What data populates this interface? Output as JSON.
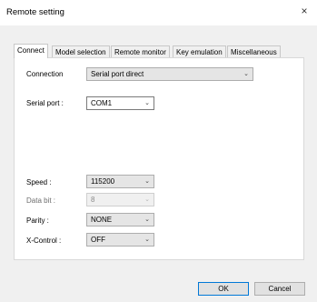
{
  "window": {
    "title": "Remote setting",
    "close_glyph": "×"
  },
  "tabs": [
    {
      "label": "Connect",
      "active": true
    },
    {
      "label": "Model selection"
    },
    {
      "label": "Remote monitor"
    },
    {
      "label": "Key emulation"
    },
    {
      "label": "Miscellaneous"
    }
  ],
  "connection": {
    "label": "Connection",
    "value": "Serial port direct"
  },
  "serial_port": {
    "label": "Serial port :",
    "value": "COM1"
  },
  "speed": {
    "label": "Speed :",
    "value": "115200"
  },
  "data_bit": {
    "label": "Data bit :",
    "value": "8"
  },
  "parity": {
    "label": "Parity :",
    "value": "NONE"
  },
  "x_control": {
    "label": "X-Control :",
    "value": "OFF"
  },
  "buttons": {
    "ok": "OK",
    "cancel": "Cancel"
  },
  "colors": {
    "focus_border": "#0078d7",
    "panel": "#ffffff",
    "dialog": "#f0f0f0"
  }
}
